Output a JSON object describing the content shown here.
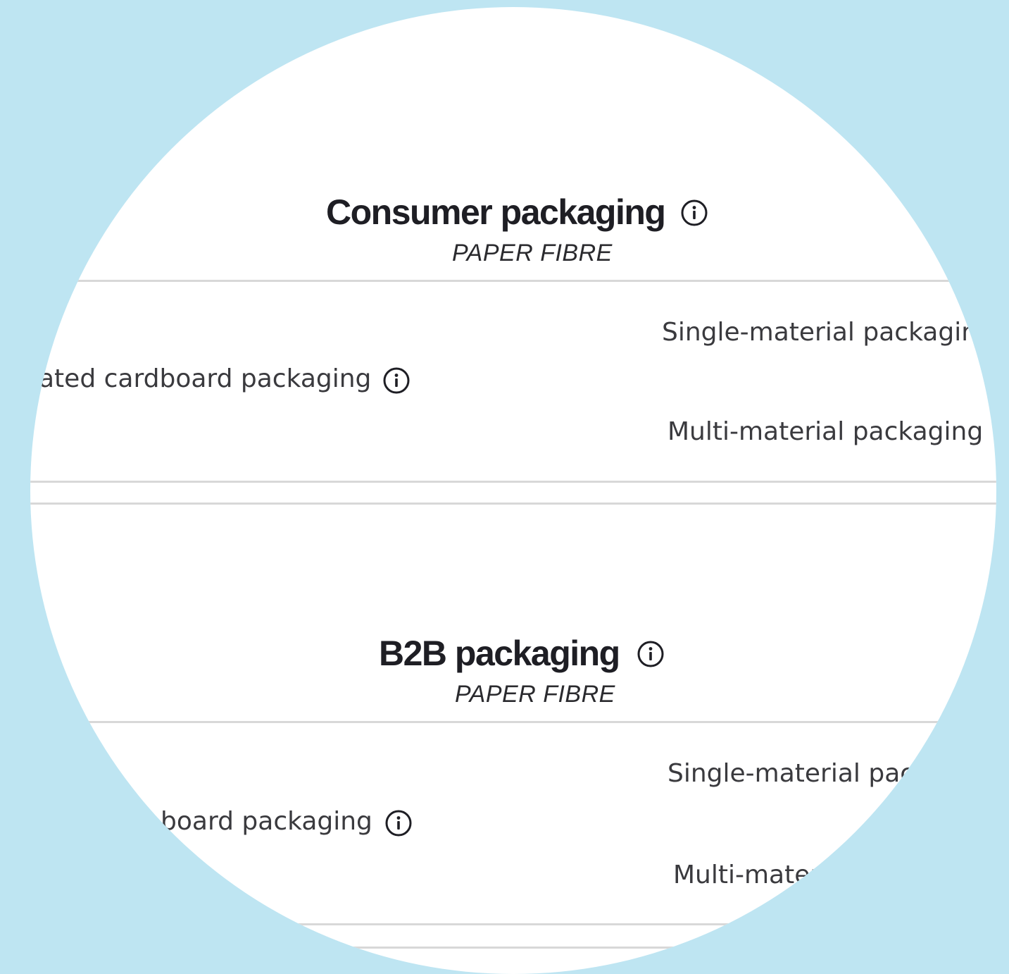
{
  "consumer": {
    "title": "Consumer packaging",
    "subtitle": "PAPER FIBRE",
    "row_label": "ated cardboard packaging",
    "options": [
      "Single-material packaging",
      "Multi-material packaging"
    ]
  },
  "b2b": {
    "title": "B2B packaging",
    "subtitle": "PAPER FIBRE",
    "row_label": "board packaging",
    "options": [
      "Single-material packaging",
      "Multi-material packaging"
    ]
  },
  "icons": {
    "info": "info-circle-icon"
  },
  "colors": {
    "background": "#bee5f2",
    "panel": "#ffffff",
    "title": "#1e1e24",
    "text": "#3a3a3e",
    "divider": "#d8d8d8"
  }
}
